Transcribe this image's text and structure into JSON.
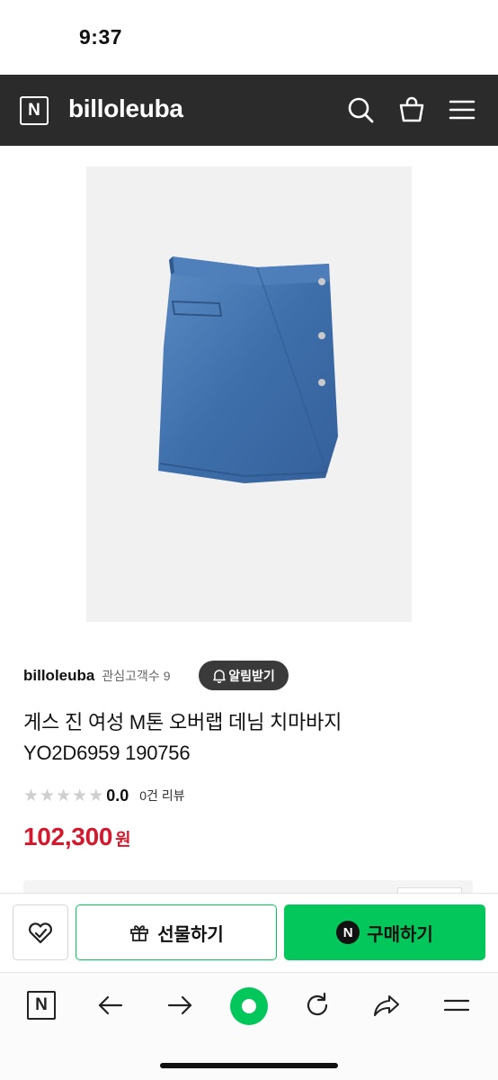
{
  "status_bar": {
    "time": "9:37"
  },
  "header": {
    "logo_letter": "N",
    "store_name": "billoleuba",
    "icons": [
      "search-icon",
      "cart-icon",
      "menu-icon"
    ]
  },
  "product": {
    "image_desc_icon": "denim-skirt-image",
    "seller": {
      "name": "billoleuba",
      "fans_label": "관심고객수",
      "fans_count": "9"
    },
    "alert_button": "알림받기",
    "title_line1": "게스 진 여성 M톤 오버랩 데님 치마바지",
    "title_line2": "YO2D6959 190756",
    "rating": {
      "value": "0.0",
      "stars_filled": 0,
      "stars_total": 5,
      "review_count": "0건 리뷰"
    },
    "price": {
      "amount": "102,300",
      "currency": "원"
    }
  },
  "actions": {
    "wish_icon": "heart-check-icon",
    "gift_label": "선물하기",
    "buy_badge": "N",
    "buy_label": "구매하기"
  },
  "browser_nav": {
    "icons": [
      "naver-home-icon",
      "back-arrow-icon",
      "forward-arrow-icon",
      "green-dot-icon",
      "reload-icon",
      "share-icon",
      "menu-icon"
    ]
  },
  "colors": {
    "header_bg": "#2b2b2b",
    "price_red": "#d4182d",
    "naver_green": "#03c75a"
  }
}
